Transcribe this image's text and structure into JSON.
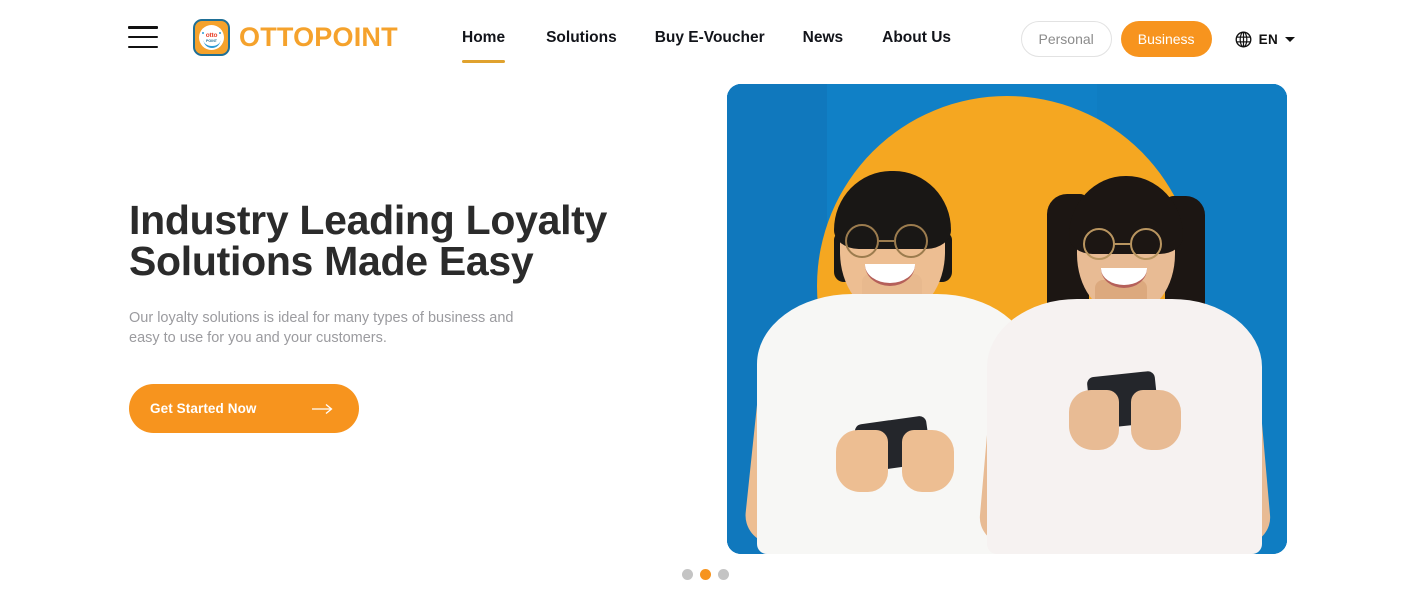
{
  "brand": {
    "wordmark": "OTTOPOINT",
    "logo_otto": "otto",
    "logo_point": "POINT",
    "logo_border_color": "#1F6F96",
    "logo_fill_color": "#F5A22C",
    "wordmark_color": "#F5A22C"
  },
  "header": {
    "menu_icon": "hamburger-menu-icon",
    "nav": [
      {
        "label": "Home",
        "active": true
      },
      {
        "label": "Solutions",
        "active": false
      },
      {
        "label": "Buy E-Voucher",
        "active": false
      },
      {
        "label": "News",
        "active": false
      },
      {
        "label": "About Us",
        "active": false
      }
    ],
    "audience_toggle": {
      "personal_label": "Personal",
      "business_label": "Business",
      "selected": "Business"
    },
    "language": {
      "icon": "globe-icon",
      "label": "EN",
      "caret": "chevron-down-icon"
    },
    "active_underline_color": "#E0A22E"
  },
  "hero": {
    "title": "Industry Leading Loyalty\nSolutions Made Easy",
    "subtitle": "Our loyalty solutions is ideal for many types of business and\neasy to use for you and your customers.",
    "cta_label": "Get Started Now",
    "cta_arrow": "arrow-right-icon",
    "cta_color": "#F7941E",
    "image_alt": "Two young people in white t-shirts smiling at their smartphones in front of a blue background with a large orange circle",
    "image_bg_color": "#1080C6",
    "image_circle_color": "#F5A721"
  },
  "carousel": {
    "total_slides": 3,
    "active_index": 1,
    "active_color": "#F7941E",
    "inactive_color": "#C4C4C4"
  }
}
